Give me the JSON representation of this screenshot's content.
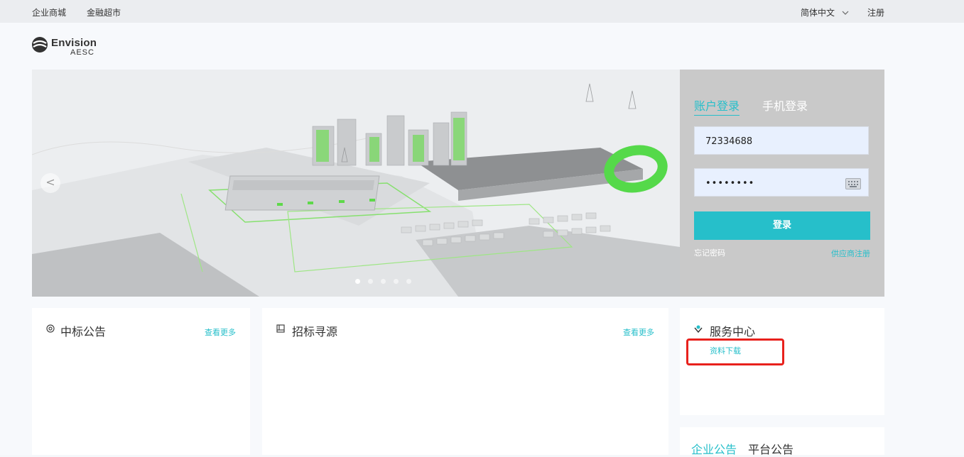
{
  "topbar": {
    "mall": "企业商城",
    "finance": "金融超市",
    "language": "简体中文",
    "register": "注册"
  },
  "logo": {
    "name": "Envision",
    "sub": "AESC"
  },
  "hero": {
    "slide_count": 5,
    "active_slide": 1
  },
  "login": {
    "tab_account": "账户登录",
    "tab_phone": "手机登录",
    "username": "72334688",
    "password_mask": "••••••••",
    "submit": "登录",
    "forgot": "忘记密码",
    "supplier_register": "供应商注册"
  },
  "cards": {
    "winning": {
      "title": "中标公告",
      "more": "查看更多"
    },
    "sourcing": {
      "title": "招标寻源",
      "more": "查看更多"
    },
    "service": {
      "title": "服务中心",
      "download": "资料下载"
    },
    "notice": {
      "tab_company": "企业公告",
      "tab_platform": "平台公告"
    }
  },
  "colors": {
    "accent": "#26bfca",
    "highlight": "#e8211c"
  }
}
